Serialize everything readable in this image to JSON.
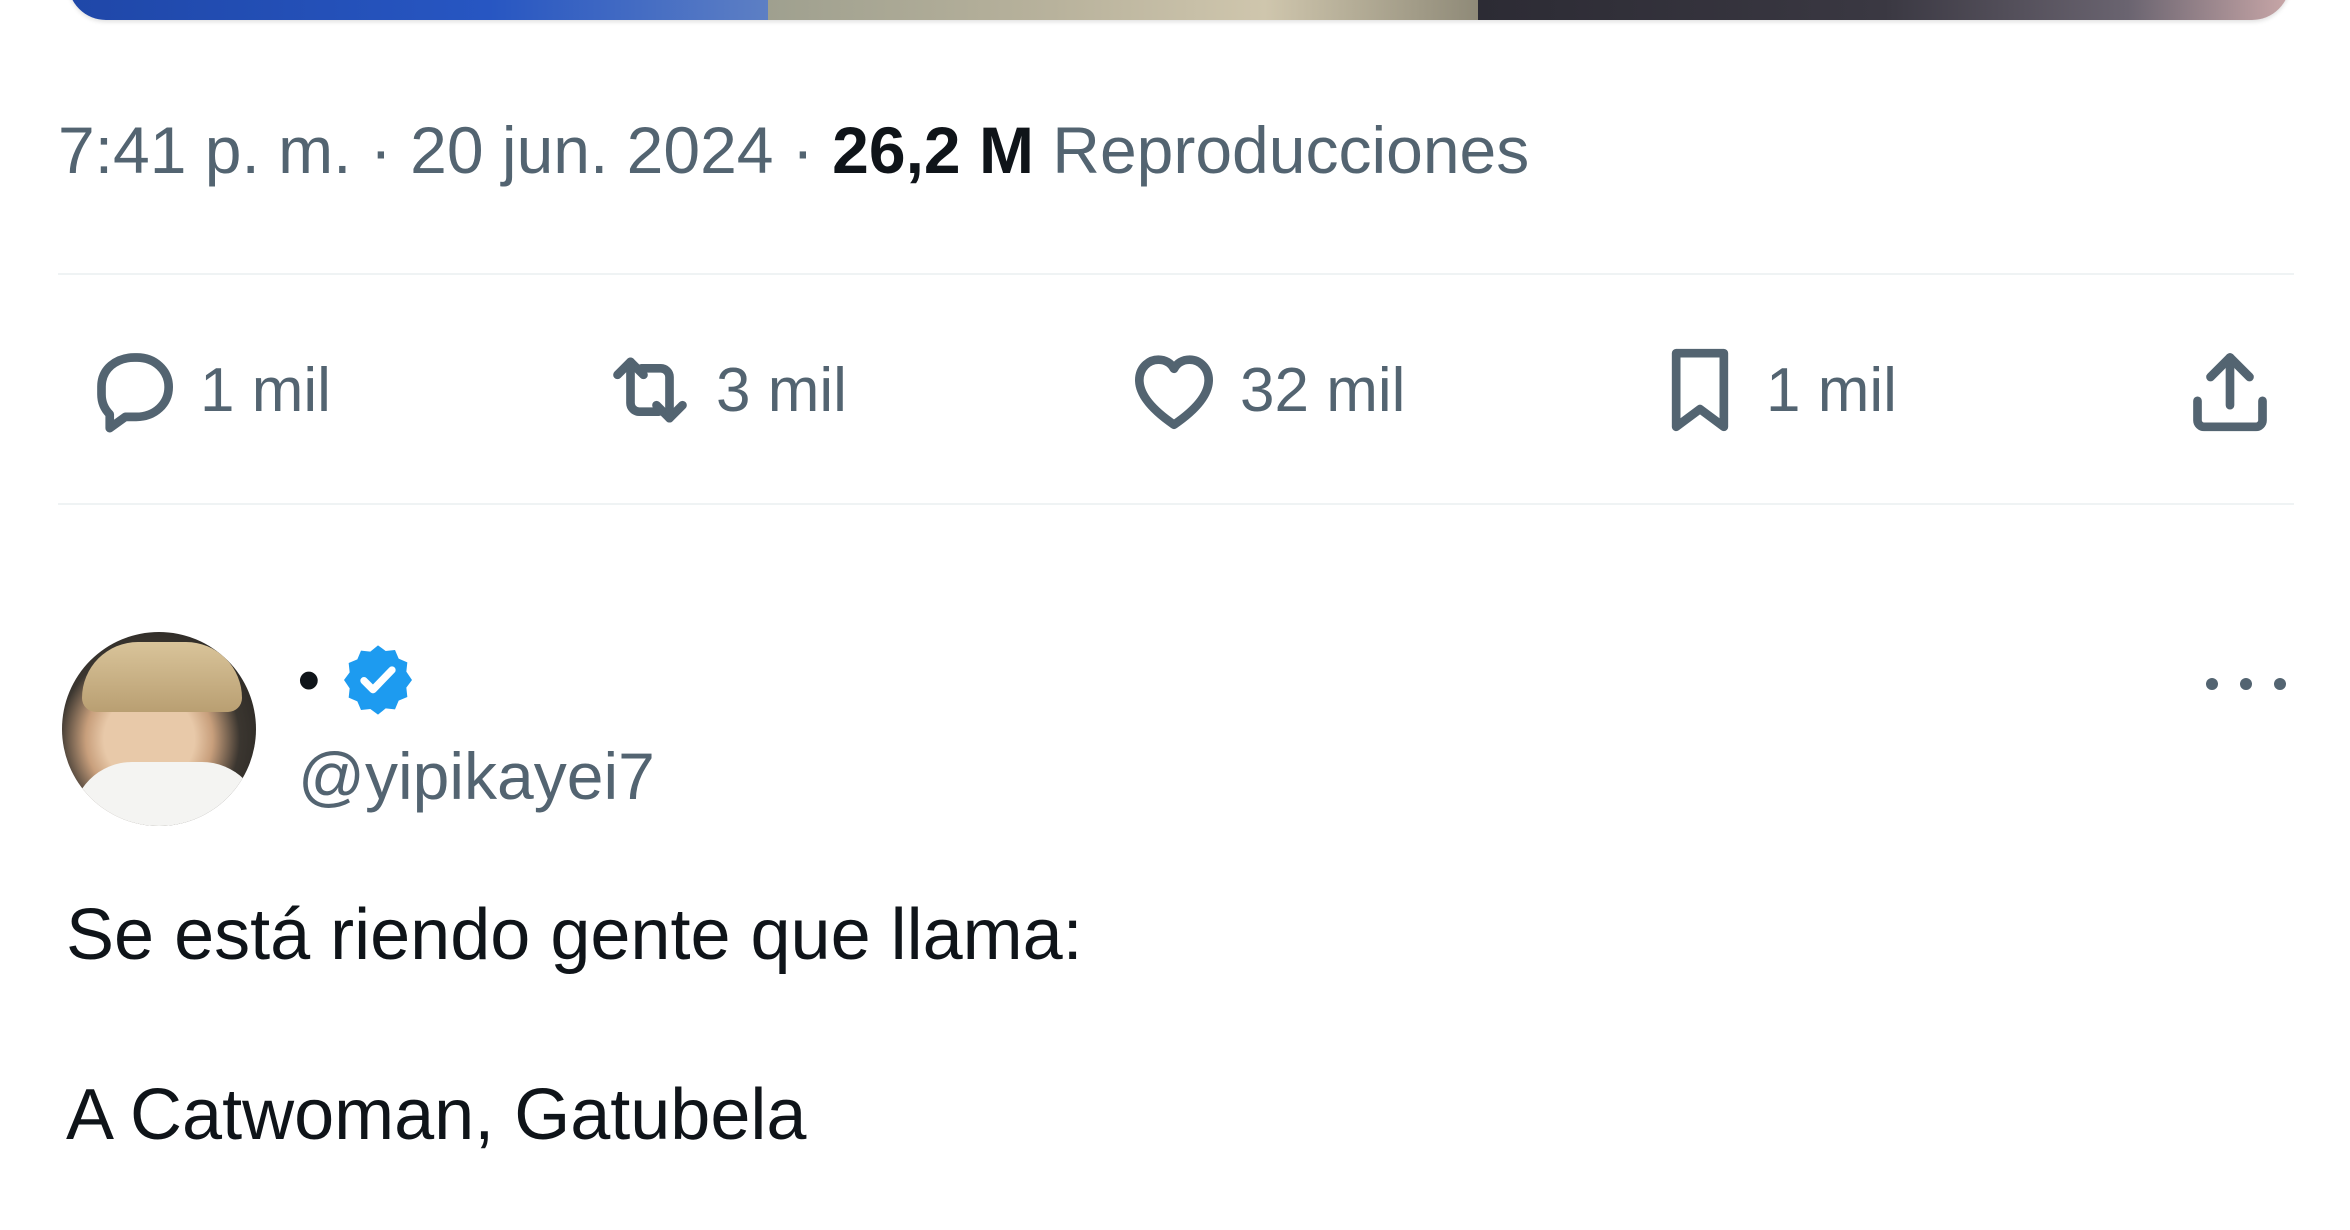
{
  "media": {
    "description_icon": "attached-image-preview"
  },
  "tweet": {
    "time": "7:41 p. m.",
    "date": "20 jun. 2024",
    "separator": "·",
    "views_count": "26,2 M",
    "views_label": "Reproducciones"
  },
  "actions": {
    "replies": {
      "icon": "reply-icon",
      "count": "1 mil"
    },
    "reposts": {
      "icon": "repost-icon",
      "count": "3 mil"
    },
    "likes": {
      "icon": "heart-icon",
      "count": "32 mil"
    },
    "bookmarks": {
      "icon": "bookmark-icon",
      "count": "1 mil"
    },
    "share": {
      "icon": "share-icon"
    }
  },
  "reply": {
    "display_name": "•",
    "handle": "@yipikayei7",
    "verified": true,
    "text_line1": "Se está riendo gente que llama:",
    "text_line2": "A Catwoman, Gatubela"
  },
  "colors": {
    "text_primary": "#0f1419",
    "text_secondary": "#536471",
    "verified_blue": "#1d9bf0",
    "divider": "#eff3f4"
  }
}
